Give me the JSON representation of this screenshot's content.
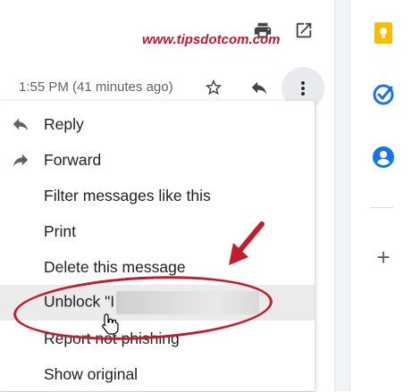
{
  "watermark": "www.tipsdotcom.com",
  "email_header": {
    "timestamp": "1:55 PM (41 minutes ago)"
  },
  "toolbar_icons": [
    "print-icon",
    "open-in-new-window-icon"
  ],
  "header_icons": [
    "star-icon",
    "reply-icon",
    "more-vert-icon"
  ],
  "menu": {
    "items": [
      {
        "label": "Reply",
        "icon": "reply-icon"
      },
      {
        "label": "Forward",
        "icon": "forward-icon"
      },
      {
        "label": "Filter messages like this"
      },
      {
        "label": "Print"
      },
      {
        "label": "Delete this message"
      },
      {
        "label": "Unblock \"I",
        "highlighted": true,
        "redacted_suffix": true
      },
      {
        "label": "Report not phishing"
      },
      {
        "label": "Show original"
      }
    ]
  },
  "side_panel": {
    "apps": [
      "keep-icon",
      "tasks-icon",
      "contacts-icon"
    ],
    "add_label": "+"
  },
  "colors": {
    "annotation_red": "#c11d2b",
    "keep_yellow": "#fbbc04",
    "tasks_blue": "#1a73e8",
    "contacts_blue": "#1a73e8",
    "hover_bg": "#ebebeb"
  }
}
